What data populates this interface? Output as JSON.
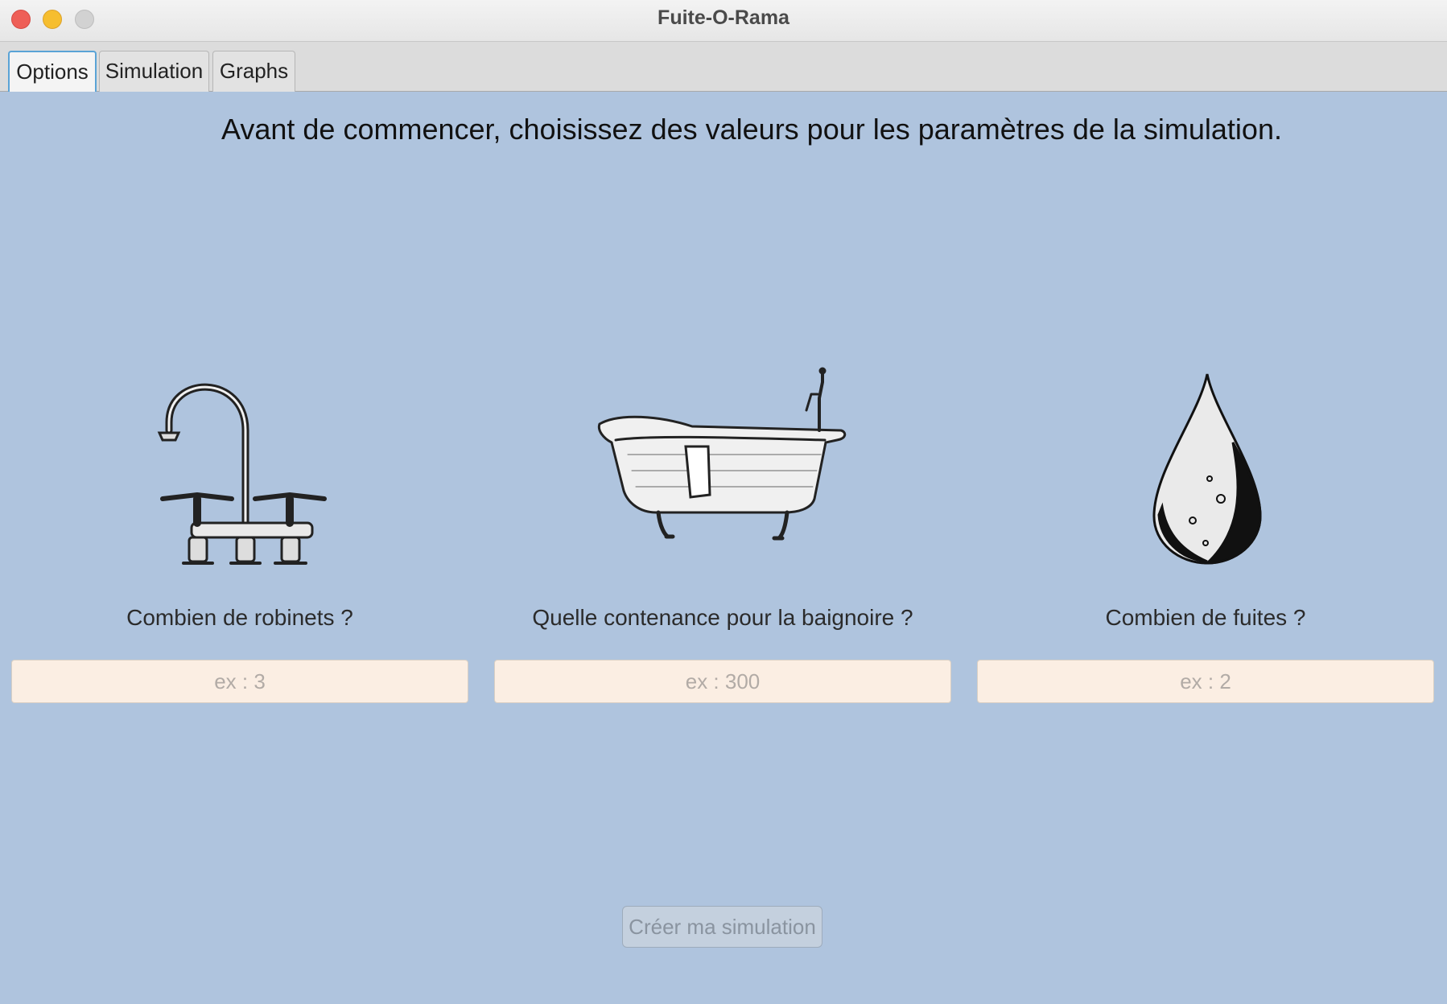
{
  "window": {
    "title": "Fuite-O-Rama"
  },
  "tabs": [
    {
      "label": "Options",
      "active": true
    },
    {
      "label": "Simulation",
      "active": false
    },
    {
      "label": "Graphs",
      "active": false
    }
  ],
  "main": {
    "heading": "Avant de commencer, choisissez des valeurs pour les paramètres de la simulation.",
    "params": [
      {
        "icon": "faucet-icon",
        "label": "Combien de robinets ?",
        "value": "",
        "placeholder": "ex : 3"
      },
      {
        "icon": "bathtub-icon",
        "label": "Quelle contenance pour la baignoire ?",
        "value": "",
        "placeholder": "ex : 300"
      },
      {
        "icon": "water-drop-icon",
        "label": "Combien de fuites ?",
        "value": "",
        "placeholder": "ex : 2"
      }
    ],
    "create_button": {
      "label": "Créer ma simulation",
      "enabled": false
    }
  },
  "colors": {
    "background": "#afc4de",
    "field_background": "#fbeee3",
    "tab_active_border": "#5aa3d6"
  }
}
